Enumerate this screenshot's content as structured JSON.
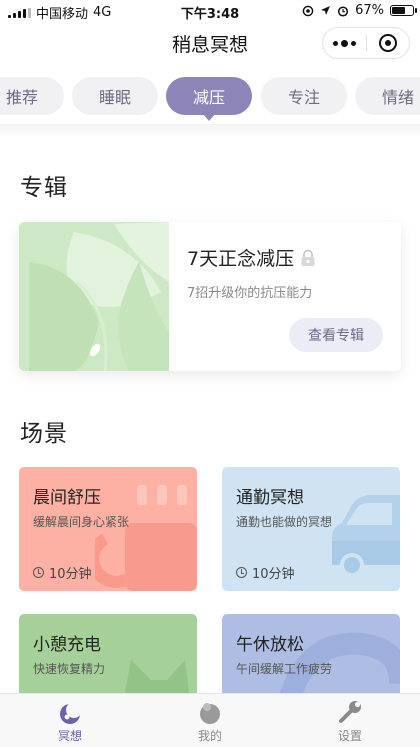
{
  "status_bar": {
    "carrier": "中国移动",
    "network": "4G",
    "time": "下午3:48",
    "battery": "67%",
    "battery_level": 0.67
  },
  "nav": {
    "title": "稍息冥想"
  },
  "categories": [
    {
      "label": "推荐",
      "active": false
    },
    {
      "label": "睡眠",
      "active": false
    },
    {
      "label": "减压",
      "active": true
    },
    {
      "label": "专注",
      "active": false
    },
    {
      "label": "情绪",
      "active": false
    }
  ],
  "album_section": {
    "title": "专辑",
    "album": {
      "name": "7天正念减压",
      "description": "7招升级你的抗压能力",
      "button": "查看专辑",
      "locked": true
    }
  },
  "scene_section": {
    "title": "场景",
    "scenes": [
      {
        "title": "晨间舒压",
        "description": "缓解晨间身心紧张",
        "duration": "10分钟",
        "color": "#fdb1a4",
        "icon": "coffee-cup-icon"
      },
      {
        "title": "通勤冥想",
        "description": "通勤也能做的冥想",
        "duration": "10分钟",
        "color": "#cfe3f3",
        "icon": "car-icon"
      },
      {
        "title": "小憩充电",
        "description": "快速恢复精力",
        "duration": "",
        "color": "#a6d09a",
        "icon": "cat-icon"
      },
      {
        "title": "午休放松",
        "description": "午间缓解工作疲劳",
        "duration": "",
        "color": "#aebde4",
        "icon": "arc-icon"
      }
    ]
  },
  "tabbar": {
    "items": [
      {
        "label": "冥想",
        "icon": "moon-meditation-icon",
        "active": true
      },
      {
        "label": "我的",
        "icon": "avatar-icon",
        "active": false
      },
      {
        "label": "设置",
        "icon": "wrench-icon",
        "active": false
      }
    ]
  },
  "colors": {
    "accent": "#8d85b8",
    "tab_inactive_bg": "#f1f1f3",
    "album_art_bg": "#cde8c4"
  }
}
